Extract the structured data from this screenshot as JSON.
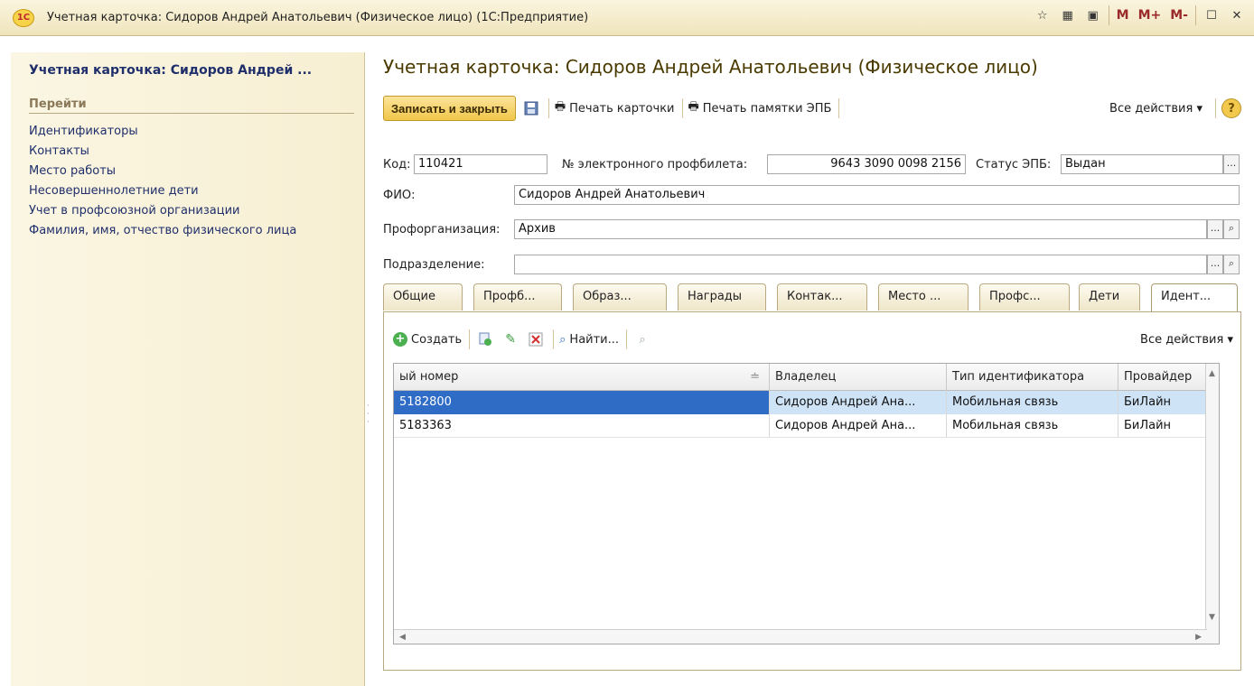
{
  "window": {
    "title": "Учетная карточка: Сидоров Андрей Анатольевич (Физическое лицо)  (1С:Предприятие)",
    "logo_text": "1С",
    "m_buttons": [
      "M",
      "M+",
      "M-"
    ]
  },
  "sidebar": {
    "title": "Учетная карточка: Сидоров Андрей ...",
    "section": "Перейти",
    "items": [
      {
        "label": "Идентификаторы"
      },
      {
        "label": "Контакты"
      },
      {
        "label": "Место работы"
      },
      {
        "label": "Несовершеннолетние дети"
      },
      {
        "label": "Учет в профсоюзной организации"
      },
      {
        "label": "Фамилия, имя, отчество физического лица"
      }
    ]
  },
  "form": {
    "title": "Учетная карточка: Сидоров Андрей Анатольевич (Физическое лицо)",
    "toolbar": {
      "save_close": "Записать и закрыть",
      "print_card": "Печать карточки",
      "print_memo": "Печать памятки ЭПБ",
      "all_actions": "Все действия ▾",
      "help": "?"
    },
    "fields": {
      "code_label": "Код:",
      "code_value": "110421",
      "ticket_label": "№ электронного профбилета:",
      "ticket_value": "9643 3090 0098 2156",
      "status_label": "Статус ЭПБ:",
      "status_value": "Выдан",
      "fio_label": "ФИО:",
      "fio_value": "Сидоров Андрей Анатольевич",
      "org_label": "Профорганизация:",
      "org_value": "Архив",
      "dept_label": "Подразделение:",
      "dept_value": ""
    },
    "tabs": [
      {
        "label": "Общие"
      },
      {
        "label": "Профб..."
      },
      {
        "label": "Образ..."
      },
      {
        "label": "Награды"
      },
      {
        "label": "Контак..."
      },
      {
        "label": "Место ..."
      },
      {
        "label": "Профс..."
      },
      {
        "label": "Дети"
      },
      {
        "label": "Идент..."
      }
    ],
    "panel_toolbar": {
      "create": "Создать",
      "find": "Найти...",
      "all_actions": "Все действия ▾"
    },
    "grid": {
      "columns": [
        "ый номер",
        "Владелец",
        "Тип идентификатора",
        "Провайдер"
      ],
      "rows": [
        {
          "number": "5182800",
          "owner": "Сидоров Андрей Ана...",
          "type": "Мобильная связь",
          "provider": "БиЛайн"
        },
        {
          "number": "5183363",
          "owner": "Сидоров Андрей Ана...",
          "type": "Мобильная связь",
          "provider": "БиЛайн"
        }
      ]
    }
  },
  "colors": {
    "accent": "#f1c74a",
    "selection": "#2f6cc5",
    "selection_light": "#cfe3f7",
    "sidebar_link": "#1f2f6b"
  }
}
